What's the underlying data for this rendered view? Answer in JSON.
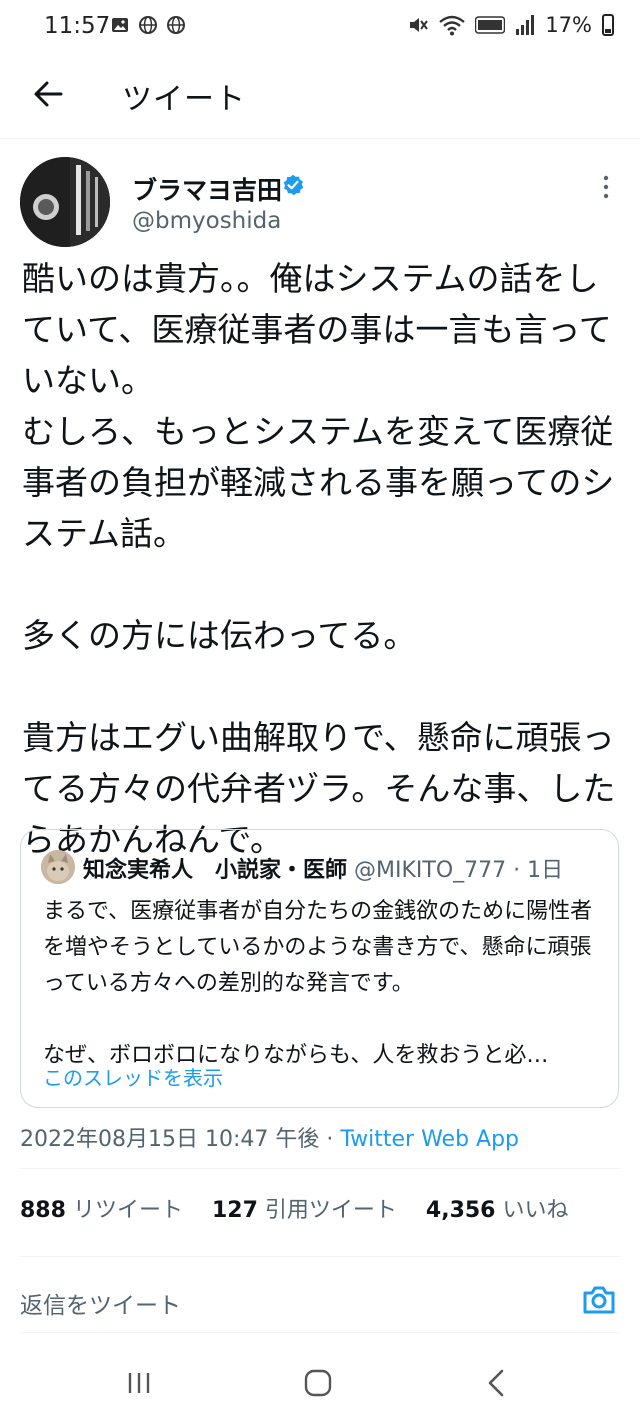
{
  "status_bar": {
    "time": "11:57",
    "battery": "17%",
    "icons": [
      "image-icon",
      "globe-icon",
      "globe-icon",
      "mute-icon",
      "wifi-icon",
      "volte-icon",
      "signal-icon",
      "battery-icon"
    ]
  },
  "header": {
    "title": "ツイート"
  },
  "tweet": {
    "author_name": "ブラマヨ吉田",
    "author_handle": "@bmyoshida",
    "text": "酷いのは貴方。。俺はシステムの話をしていて、医療従事者の事は一言も言っていない。\nむしろ、もっとシステムを変えて医療従事者の負担が軽減される事を願ってのシステム話。\n\n多くの方には伝わってる。\n\n貴方はエグい曲解取りで、懸命に頑張ってる方々の代弁者ヅラ。そんな事、したらあかんねんで。",
    "timestamp": "2022年08月15日 10:47 午後",
    "separator": " · ",
    "app": "Twitter Web App"
  },
  "quote": {
    "author_name": "知念実希人　小説家・医師",
    "author_handle": "@MIKITO_777",
    "time": "· 1日",
    "text": "まるで、医療従事者が自分たちの金銭欲のために陽性者を増やそうとしているかのような書き方で、懸命に頑張っている方々への差別的な発言です。\n\nなぜ、ボロボロになりながらも、人を救おうと必…",
    "show_thread": "このスレッドを表示"
  },
  "stats": {
    "retweets": "888",
    "retweets_label": "リツイート",
    "quotes": "127",
    "quotes_label": "引用ツイート",
    "likes": "4,356",
    "likes_label": "いいね"
  },
  "reply": {
    "placeholder": "返信をツイート"
  },
  "colors": {
    "accent": "#1d9bf0",
    "text": "#0f1419",
    "secondary": "#536471",
    "border": "#cfd9de"
  }
}
